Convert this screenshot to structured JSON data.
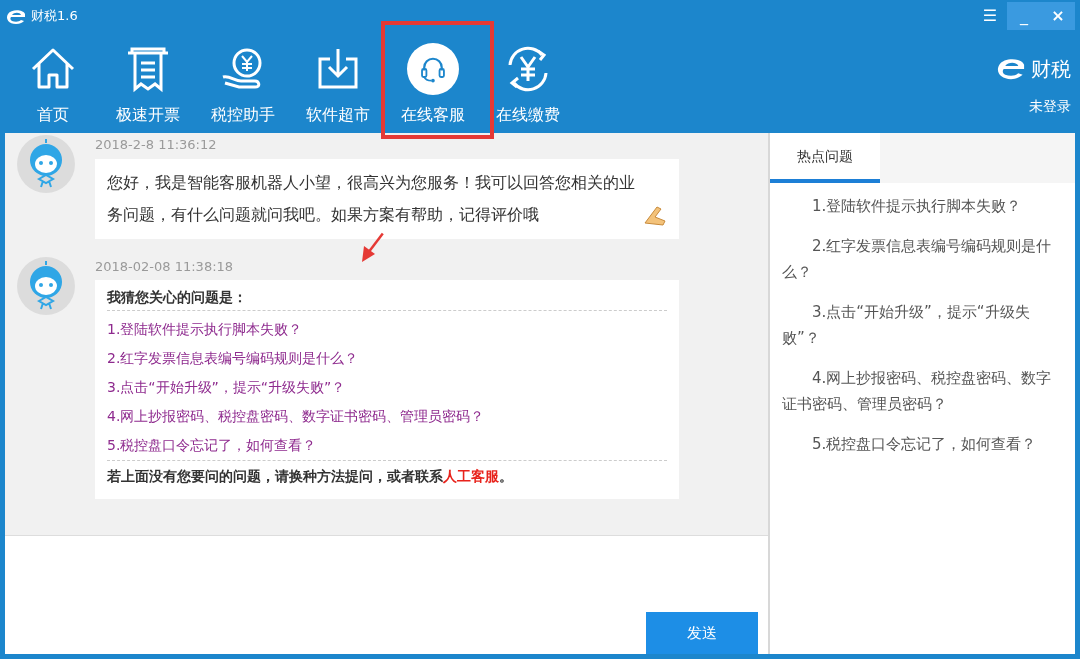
{
  "window": {
    "title": "财税1.6",
    "controls": [
      "☰",
      "_",
      "×"
    ]
  },
  "nav": [
    {
      "label": "首页",
      "selected": false,
      "highlighted": false
    },
    {
      "label": "极速开票",
      "selected": false,
      "highlighted": false
    },
    {
      "label": "税控助手",
      "selected": false,
      "highlighted": false
    },
    {
      "label": "软件超市",
      "selected": false,
      "highlighted": false
    },
    {
      "label": "在线客服",
      "selected": true,
      "highlighted": true
    },
    {
      "label": "在线缴费",
      "selected": false,
      "highlighted": false
    }
  ],
  "brand": {
    "logo": "财税",
    "user": "未登录"
  },
  "messages": [
    {
      "kind": "text",
      "time": "2018-2-8 11:36:12",
      "text": "您好，我是智能客服机器人小望，很高兴为您服务！我可以回答您相关的业务问题，有什么问题就问我吧。如果方案有帮助，记得评价哦"
    },
    {
      "kind": "suggestions",
      "time": "2018-02-08 11:38:18",
      "heading": "我猜您关心的问题是：",
      "items": [
        "1.登陆软件提示执行脚本失败？",
        "2.红字发票信息表编号编码规则是什么？",
        "3.点击“开始升级”，提示“升级失败”？",
        "4.网上抄报密码、税控盘密码、数字证书密码、管理员密码？",
        "5.税控盘口令忘记了，如何查看？"
      ],
      "footer": "若上面没有您要问的问题，请换种方法提问，或者联系",
      "footer_link": "人工客服",
      "footer_end": "。"
    }
  ],
  "send_button": "发送",
  "hot_panel": {
    "tabs": [
      {
        "label": "热点问题",
        "selected": true
      }
    ],
    "items": [
      "1.登陆软件提示执行脚本失败？",
      "2.红字发票信息表编号编码规则是什么？",
      "3.点击“开始升级”，提示“升级失败”？",
      "4.网上抄报密码、税控盘密码、数字证书密码、管理员密码？",
      "5.税控盘口令忘记了，如何查看？"
    ]
  }
}
